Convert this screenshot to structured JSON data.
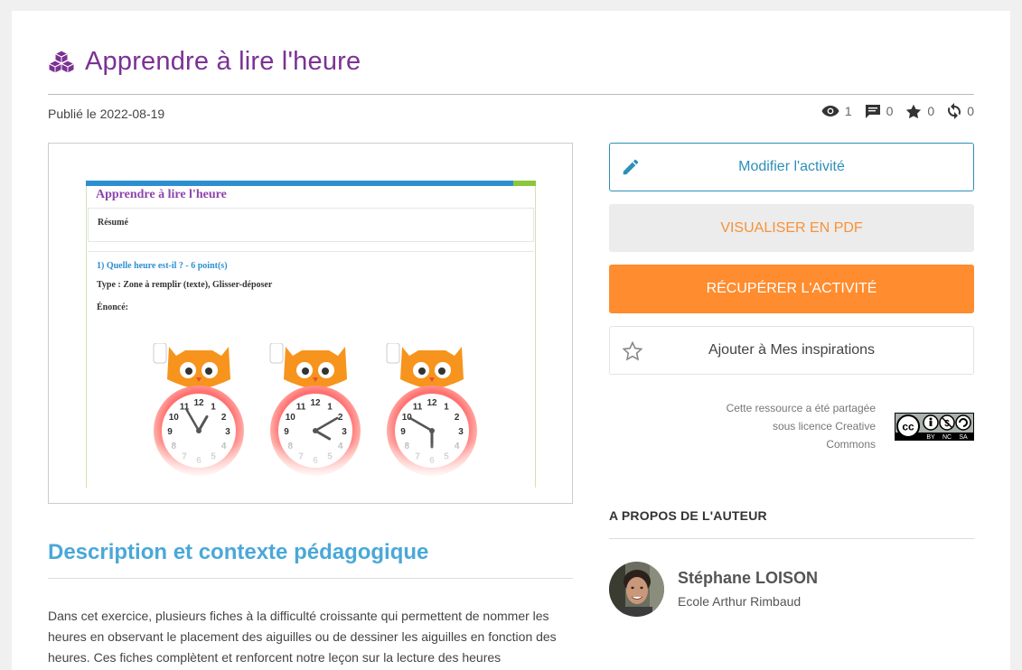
{
  "page": {
    "title": "Apprendre à lire l'heure",
    "published": "Publié le 2022-08-19",
    "icon": "cubes-icon",
    "title_color": "#7b3294"
  },
  "stats": {
    "views": "1",
    "comments": "0",
    "stars": "0",
    "shares": "0"
  },
  "preview": {
    "doc_title": "Apprendre à lire l'heure",
    "resume_label": "Résumé",
    "question": "1) Quelle heure est-il ? - 6 point(s)",
    "type": "Type : Zone à remplir (texte), Glisser-déposer",
    "enonce": "Énoncé:",
    "clock_numbers": [
      "12",
      "1",
      "2",
      "3",
      "4",
      "5",
      "6",
      "7",
      "8",
      "9",
      "10",
      "11"
    ]
  },
  "actions": {
    "edit_label": "Modifier l'activité",
    "pdf_label": "Visualiser en PDF",
    "get_label": "Récupérer l'activité",
    "inspiration_label": "Ajouter à Mes inspirations",
    "accent": "#ff8c2e",
    "edit_color": "#2e8fb8"
  },
  "license": {
    "line1": "Cette ressource a été partagée",
    "line2": "sous licence Creative",
    "line3": "Commons",
    "badge_labels": [
      "BY",
      "NC",
      "SA"
    ],
    "badge_icon": "cc-license-icon"
  },
  "author": {
    "section_title": "A PROPOS DE L'AUTEUR",
    "name": "Stéphane LOISON",
    "school": "Ecole Arthur Rimbaud"
  },
  "description": {
    "title": "Description et contexte pédagogique",
    "line1": "Dans cet exercice, plusieurs fiches à la difficulté croissante qui permettent de nommer les",
    "line2": "heures en observant le placement des aiguilles ou de dessiner les aiguilles en fonction des",
    "line3": "heures. Ces fiches complètent et renforcent notre leçon sur la lecture des heures"
  }
}
